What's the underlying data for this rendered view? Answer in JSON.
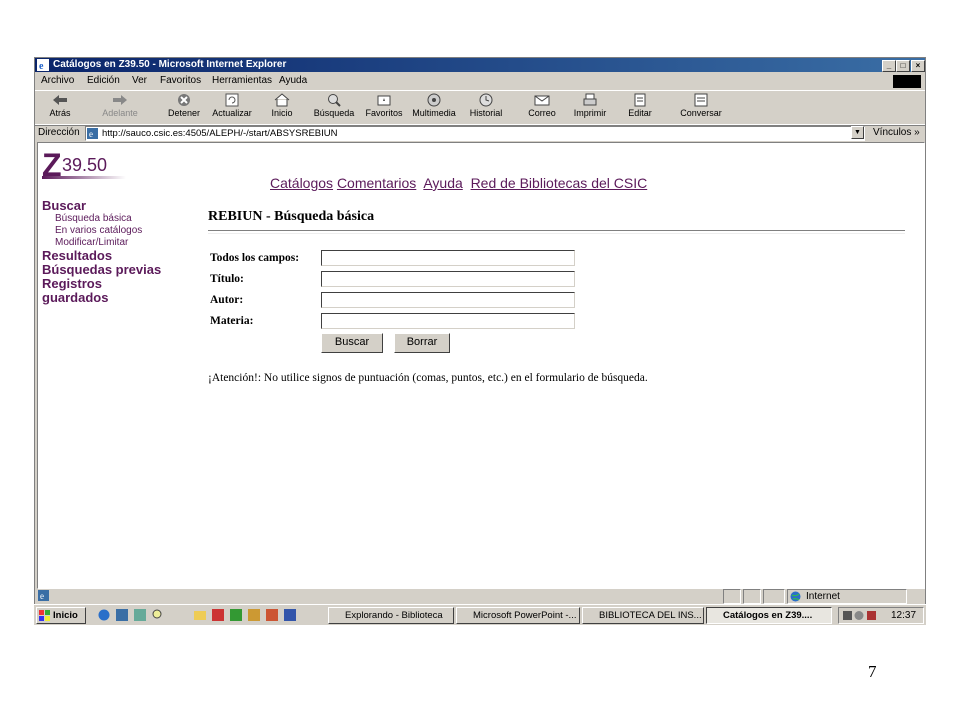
{
  "window": {
    "title": "Catálogos en Z39.50 - Microsoft Internet Explorer",
    "min": "_",
    "max": "□",
    "close": "×"
  },
  "menu": [
    "Archivo",
    "Edición",
    "Ver",
    "Favoritos",
    "Herramientas",
    "Ayuda"
  ],
  "toolbar": {
    "back": "Atrás",
    "forward": "Adelante",
    "stop": "Detener",
    "refresh": "Actualizar",
    "home": "Inicio",
    "search": "Búsqueda",
    "favorites": "Favoritos",
    "media": "Multimedia",
    "history": "Historial",
    "mail": "Correo",
    "print": "Imprimir",
    "edit": "Editar",
    "discuss": "Conversar"
  },
  "address": {
    "label": "Dirección",
    "url": "http://sauco.csic.es:4505/ALEPH/-/start/ABSYSREBIUN",
    "links": "Vínculos »"
  },
  "logo": {
    "z": "Z",
    "num": "39.50"
  },
  "topnav": [
    "Catálogos",
    "Comentarios",
    "Ayuda",
    "Red de Bibliotecas del CSIC"
  ],
  "sidebar": {
    "buscar": "Buscar",
    "basica": "Búsqueda básica",
    "varios": "En varios catálogos",
    "modificar": "Modificar/Limitar",
    "resultados": "Resultados",
    "previas": "Búsquedas previas",
    "registros": "Registros",
    "guardados": "guardados"
  },
  "page": {
    "heading": "REBIUN - Búsqueda básica",
    "fields": [
      {
        "label": "Todos los campos:",
        "value": ""
      },
      {
        "label": "Título:",
        "value": ""
      },
      {
        "label": "Autor:",
        "value": ""
      },
      {
        "label": "Materia:",
        "value": ""
      }
    ],
    "search_button": "Buscar",
    "clear_button": "Borrar",
    "notice": "¡Atención!: No utilice signos de puntuación (comas, puntos, etc.) en el formulario de búsqueda."
  },
  "status": {
    "zone": "Internet"
  },
  "taskbar": {
    "start": "Inicio",
    "tasks": [
      "Explorando - Biblioteca",
      "Microsoft PowerPoint -...",
      "BIBLIOTECA DEL INS...",
      "Catálogos en Z39...."
    ],
    "clock": "12:37"
  },
  "slide_number": "7",
  "colors": {
    "accent": "#5b1a5a",
    "titlebar": "#0a246a",
    "chrome": "#d4d0c8"
  }
}
